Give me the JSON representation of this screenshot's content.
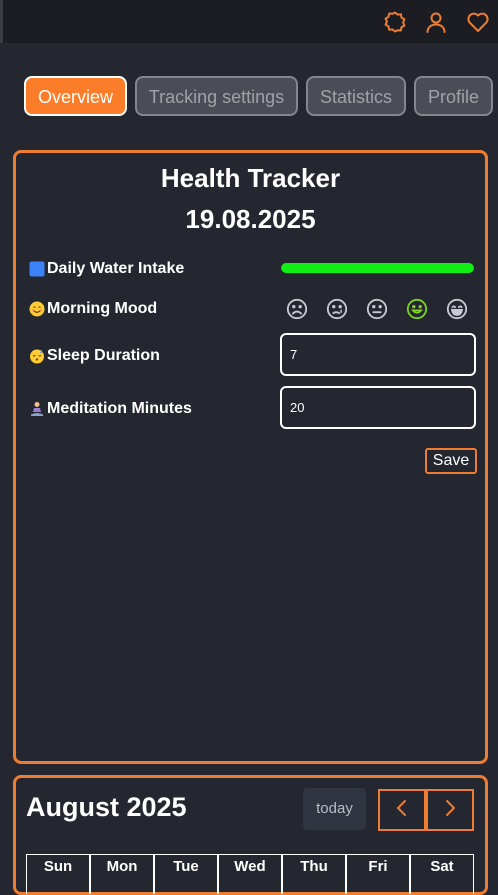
{
  "header": {
    "icons": [
      "badge-icon",
      "user-icon",
      "heart-icon"
    ],
    "accent": "#ee7d32"
  },
  "tabs": [
    {
      "label": "Overview",
      "active": true
    },
    {
      "label": "Tracking settings",
      "active": false
    },
    {
      "label": "Statistics",
      "active": false
    },
    {
      "label": "Profile",
      "active": false
    }
  ],
  "tracker": {
    "title": "Health Tracker",
    "date": "19.08.2025",
    "water": {
      "label": "Daily Water Intake",
      "icon": "blue-square-icon",
      "progress": 1.0,
      "color": "#12f013"
    },
    "mood": {
      "label": "Morning Mood",
      "icon": "smiling-face-icon",
      "options": [
        "frown-icon",
        "sad-icon",
        "neutral-icon",
        "smile-icon",
        "grin-icon"
      ],
      "selected_index": 3,
      "selected_color": "#7ed321"
    },
    "sleep": {
      "label": "Sleep Duration",
      "icon": "sleeping-face-icon",
      "value": "7"
    },
    "meditation": {
      "label": "Meditation Minutes",
      "icon": "meditating-person-icon",
      "value": "20"
    },
    "save_label": "Save"
  },
  "calendar": {
    "title": "August 2025",
    "today_label": "today",
    "prev_icon": "chevron-left-icon",
    "next_icon": "chevron-right-icon",
    "weekdays": [
      "Sun",
      "Mon",
      "Tue",
      "Wed",
      "Thu",
      "Fri",
      "Sat"
    ]
  }
}
